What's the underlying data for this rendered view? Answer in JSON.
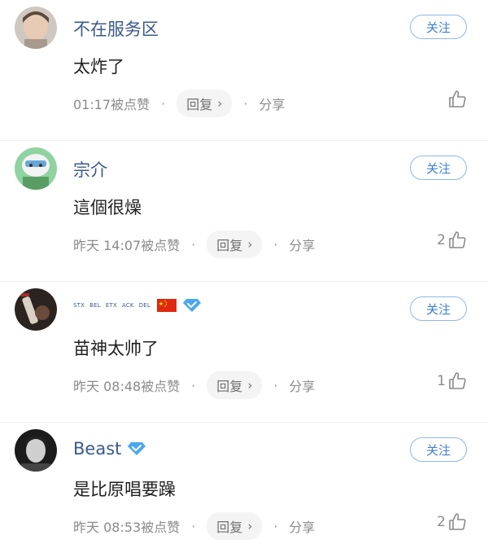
{
  "comments": [
    {
      "username": "不在服务区",
      "follow_label": "关注",
      "text": "太炸了",
      "time": "01:17被点赞",
      "reply_label": "回复",
      "share_label": "分享",
      "likes": ""
    },
    {
      "username": "宗介",
      "follow_label": "关注",
      "text": "這個很燥",
      "time": "昨天 14:07被点赞",
      "reply_label": "回复",
      "share_label": "分享",
      "likes": "2"
    },
    {
      "username": "",
      "tags": [
        "STX",
        "BEL",
        "ETX",
        "ACK",
        "DEL"
      ],
      "follow_label": "关注",
      "text": "苗神太帅了",
      "time": "昨天 08:48被点赞",
      "reply_label": "回复",
      "share_label": "分享",
      "likes": "1"
    },
    {
      "username": "Beast",
      "follow_label": "关注",
      "text": "是比原唱要躁",
      "time": "昨天 08:53被点赞",
      "reply_label": "回复",
      "share_label": "分享",
      "likes": "2"
    }
  ],
  "icons": {
    "chevron": "chevron-right-icon",
    "like": "thumbs-up-icon",
    "verified": "diamond-verified-icon",
    "flag": "china-flag-icon"
  },
  "colors": {
    "username": "#3c5a8c",
    "follow_border": "#8fb7ea",
    "follow_text": "#3f7ed6",
    "meta": "#8a8a8a",
    "verified": "#4aa8f0"
  }
}
